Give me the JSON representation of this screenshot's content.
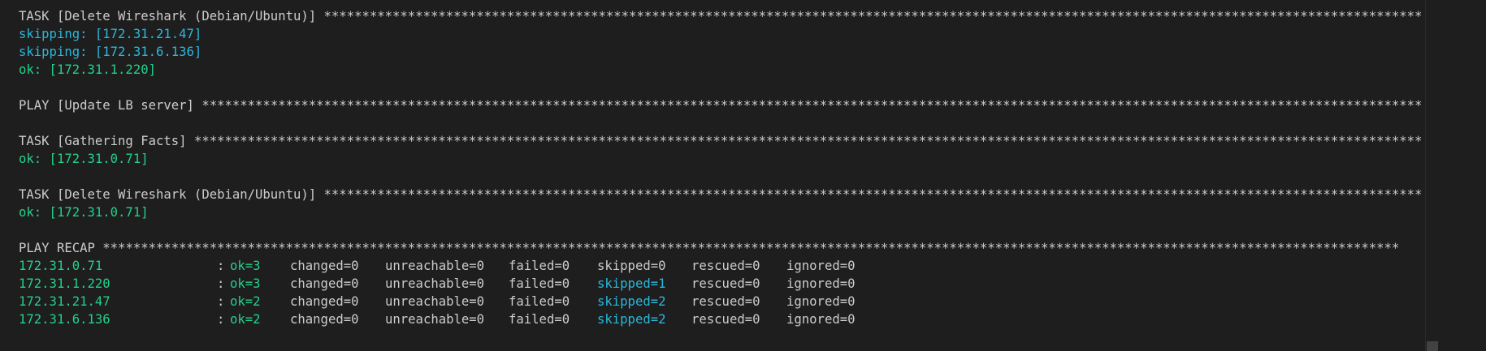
{
  "lines": {
    "l1_prefix": "TASK [Delete Wireshark (Debian/Ubuntu)] ",
    "l2": "skipping: [172.31.21.47]",
    "l3": "skipping: [172.31.6.136]",
    "l4": "ok: [172.31.1.220]",
    "l6_prefix": "PLAY [Update LB server] ",
    "l8_prefix": "TASK [Gathering Facts] ",
    "l9": "ok: [172.31.0.71]",
    "l11_prefix": "TASK [Delete Wireshark (Debian/Ubuntu)] ",
    "l12": "ok: [172.31.0.71]",
    "l14_prefix": "PLAY RECAP ",
    "stars": "**************************************************************************************************************************************************************************"
  },
  "recap": [
    {
      "host": "172.31.0.71",
      "colon": ":",
      "ok": "ok=3",
      "changed": "changed=0",
      "unreachable": "unreachable=0",
      "failed": "failed=0",
      "skipped": "skipped=0",
      "skipped_highlight": false,
      "rescued": "rescued=0",
      "ignored": "ignored=0"
    },
    {
      "host": "172.31.1.220",
      "colon": ":",
      "ok": "ok=3",
      "changed": "changed=0",
      "unreachable": "unreachable=0",
      "failed": "failed=0",
      "skipped": "skipped=1",
      "skipped_highlight": true,
      "rescued": "rescued=0",
      "ignored": "ignored=0"
    },
    {
      "host": "172.31.21.47",
      "colon": ":",
      "ok": "ok=2",
      "changed": "changed=0",
      "unreachable": "unreachable=0",
      "failed": "failed=0",
      "skipped": "skipped=2",
      "skipped_highlight": true,
      "rescued": "rescued=0",
      "ignored": "ignored=0"
    },
    {
      "host": "172.31.6.136",
      "colon": ":",
      "ok": "ok=2",
      "changed": "changed=0",
      "unreachable": "unreachable=0",
      "failed": "failed=0",
      "skipped": "skipped=2",
      "skipped_highlight": true,
      "rescued": "rescued=0",
      "ignored": "ignored=0"
    }
  ],
  "colors": {
    "background": "#1e1e1e",
    "text": "#cccccc",
    "ok_green": "#23d18b",
    "skip_cyan": "#29b8db"
  }
}
